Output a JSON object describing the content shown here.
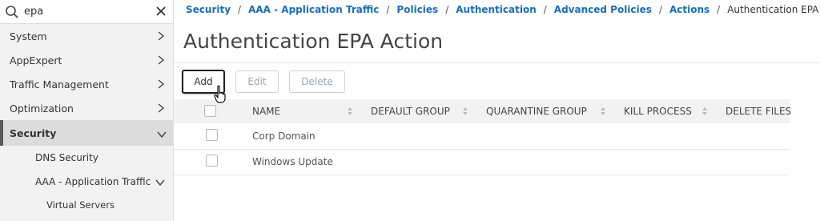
{
  "search": {
    "value": "epa"
  },
  "sidebar": {
    "items": [
      {
        "label": "System"
      },
      {
        "label": "AppExpert"
      },
      {
        "label": "Traffic Management"
      },
      {
        "label": "Optimization"
      },
      {
        "label": "Security"
      }
    ],
    "security_children": [
      {
        "label": "DNS Security"
      },
      {
        "label": "AAA - Application Traffic"
      }
    ],
    "aaa_children": [
      {
        "label": "Virtual Servers"
      }
    ]
  },
  "breadcrumb": {
    "items": [
      "Security",
      "AAA - Application Traffic",
      "Policies",
      "Authentication",
      "Advanced Policies",
      "Actions"
    ],
    "current": "Authentication EPA Action",
    "separator": "/"
  },
  "page": {
    "title": "Authentication EPA Action"
  },
  "toolbar": {
    "add_label": "Add",
    "edit_label": "Edit",
    "delete_label": "Delete"
  },
  "table": {
    "columns": [
      "NAME",
      "DEFAULT GROUP",
      "QUARANTINE GROUP",
      "KILL PROCESS",
      "DELETE FILES"
    ],
    "rows": [
      {
        "name": "Corp Domain"
      },
      {
        "name": "Windows Update"
      }
    ]
  },
  "colors": {
    "link": "#1a6fb8",
    "sidebar_bg": "#f2f2f2",
    "active_bg": "#dcdcdc"
  }
}
